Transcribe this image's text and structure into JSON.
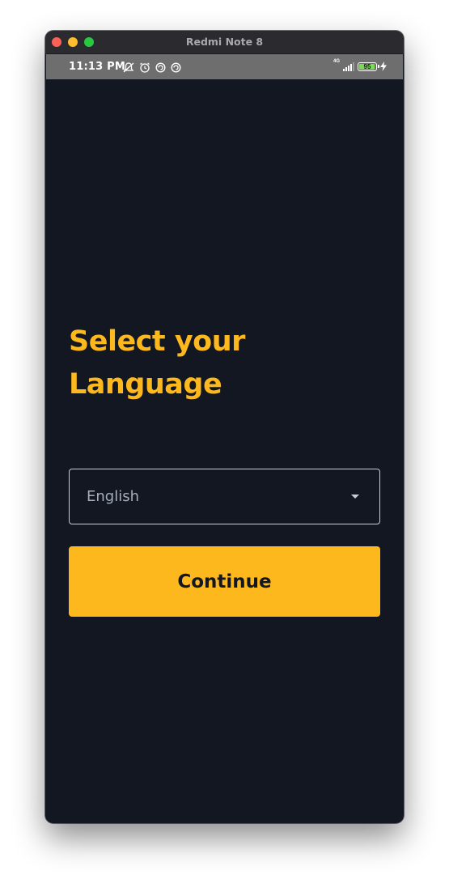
{
  "window": {
    "title": "Redmi Note 8"
  },
  "status_bar": {
    "time": "11:13 PM",
    "network": "4G",
    "battery_level": "95",
    "battery_fraction": 0.95,
    "icons": [
      "notifications-off-icon",
      "alarm-icon",
      "sync-icon",
      "sync-icon",
      "signal-icon",
      "battery-icon",
      "charging-icon"
    ]
  },
  "screen": {
    "heading_line1": "Select your",
    "heading_line2": "Language",
    "language_selected": "English",
    "continue_label": "Continue"
  },
  "colors": {
    "background": "#121722",
    "accent": "#fdb81e",
    "button_text": "#121722",
    "status_bar": "#6e6e6e"
  }
}
